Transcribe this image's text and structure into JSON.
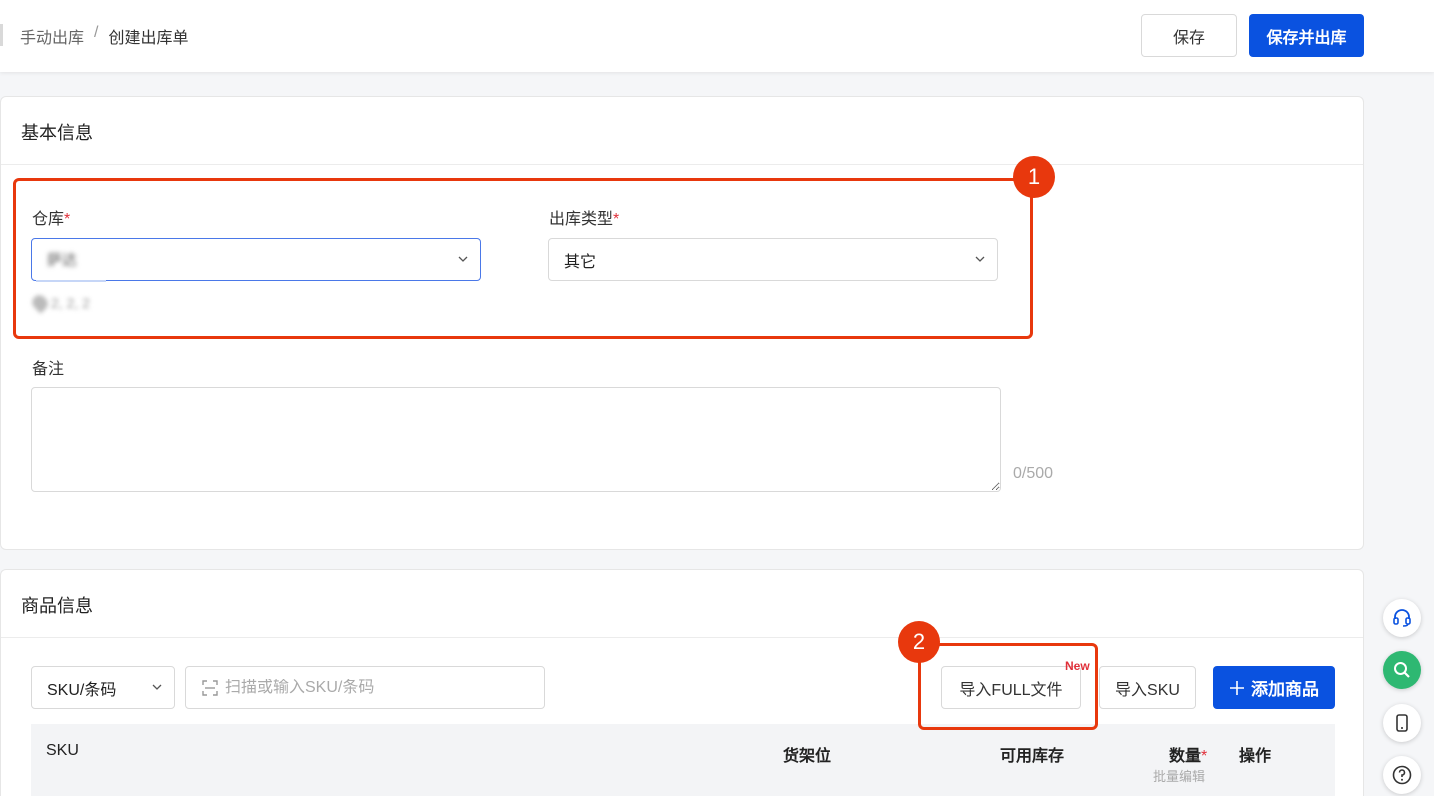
{
  "header": {
    "breadcrumb": [
      "手动出库",
      "/",
      "创建出库单"
    ],
    "save_label": "保存",
    "save_out_label": "保存并出库"
  },
  "basic": {
    "title": "基本信息",
    "warehouse_label": "仓库",
    "warehouse_value": "萨达",
    "warehouse_address": "2, 2, 2",
    "type_label": "出库类型",
    "type_value": "其它",
    "required_mark": "*",
    "remark_label": "备注",
    "remark_value": "",
    "remark_counter": "0/500"
  },
  "goods": {
    "title": "商品信息",
    "search_mode": "SKU/条码",
    "search_placeholder": "扫描或输入SKU/条码",
    "import_full_label": "导入FULL文件",
    "new_badge": "New",
    "import_sku_label": "导入SKU",
    "add_label": "添加商品",
    "columns": {
      "sku": "SKU",
      "shelf": "货架位",
      "stock": "可用库存",
      "qty": "数量",
      "qty_sub": "批量编辑",
      "ops": "操作"
    }
  },
  "annotations": [
    "1",
    "2"
  ],
  "colors": {
    "primary": "#0a52e0",
    "annotation": "#e8380d",
    "required": "#e0303a"
  }
}
